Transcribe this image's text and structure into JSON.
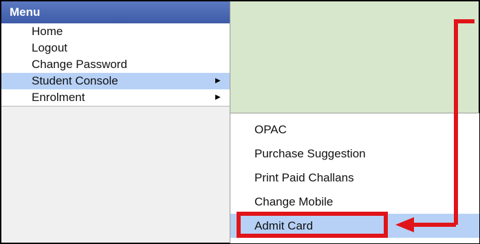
{
  "menu": {
    "title": "Menu",
    "items": [
      {
        "label": "Home"
      },
      {
        "label": "Logout"
      },
      {
        "label": "Change Password"
      },
      {
        "label": "Student Console"
      },
      {
        "label": "Enrolment"
      }
    ]
  },
  "submenu": {
    "items": [
      {
        "label": "OPAC"
      },
      {
        "label": "Purchase Suggestion"
      },
      {
        "label": "Print Paid Challans"
      },
      {
        "label": "Change Mobile"
      },
      {
        "label": "Admit Card"
      }
    ]
  },
  "colors": {
    "header": "#3d5ba8",
    "highlight": "#b7d1f6",
    "content_bg": "#d6e7cc",
    "annotation": "#e0151a"
  }
}
